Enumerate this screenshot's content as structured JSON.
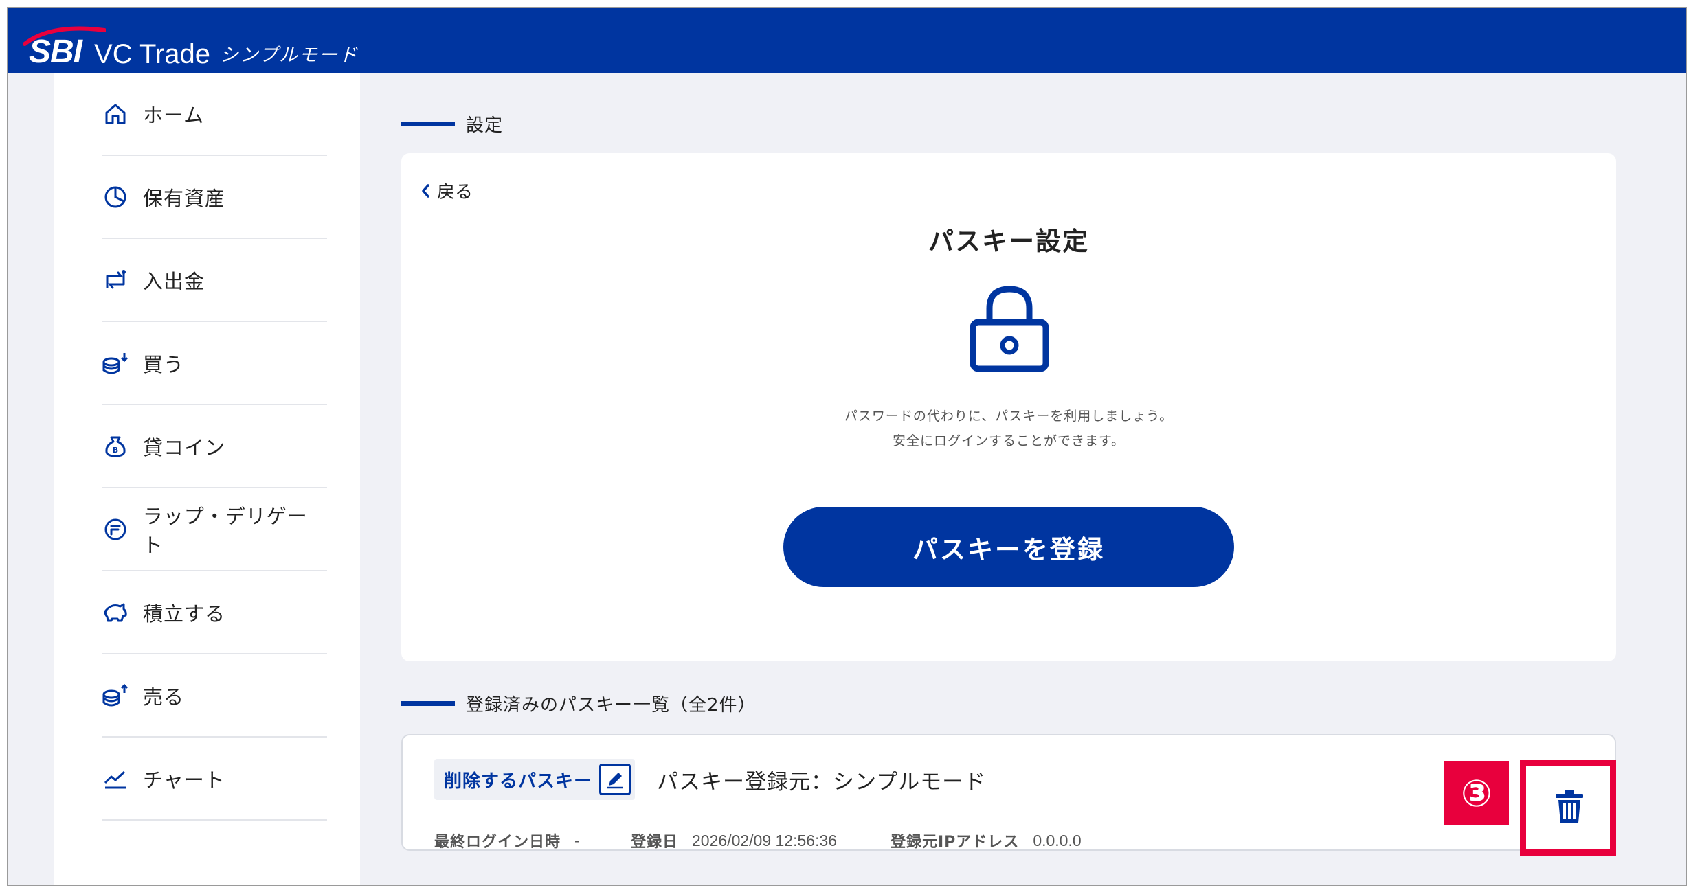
{
  "header": {
    "logo_sbi": "SBI",
    "logo_product": "VC Trade",
    "logo_mode": "シンプルモード"
  },
  "sidebar": {
    "items": [
      {
        "label": "ホーム",
        "icon": "home-icon"
      },
      {
        "label": "保有資産",
        "icon": "pie-chart-icon"
      },
      {
        "label": "入出金",
        "icon": "transfer-icon"
      },
      {
        "label": "買う",
        "icon": "coins-buy-icon"
      },
      {
        "label": "貸コイン",
        "icon": "lending-bag-icon"
      },
      {
        "label": "ラップ・デリゲート",
        "icon": "wrap-icon"
      },
      {
        "label": "積立する",
        "icon": "piggy-bank-icon"
      },
      {
        "label": "売る",
        "icon": "coins-sell-icon"
      },
      {
        "label": "チャート",
        "icon": "line-chart-icon"
      }
    ]
  },
  "main": {
    "section1_label": "設定",
    "back_label": "戻る",
    "title": "パスキー設定",
    "desc_line1": "パスワードの代わりに、パスキーを利用しましょう。",
    "desc_line2": "安全にログインすることができます。",
    "register_button": "パスキーを登録",
    "section2_label": "登録済みのパスキー一覧（全2件）",
    "passkey": {
      "tag_label": "削除するパスキー",
      "origin": "パスキー登録元：シンプルモード",
      "last_login_key": "最終ログイン日時",
      "last_login_value": "-",
      "registered_key": "登録日",
      "registered_value": "2026/02/09 12:56:36",
      "ip_key": "登録元IPアドレス",
      "ip_value": "0.0.0.0"
    },
    "step_badge": "③"
  },
  "colors": {
    "brand": "#0035a0",
    "highlight": "#e8003d",
    "background": "#f0f1f6"
  }
}
